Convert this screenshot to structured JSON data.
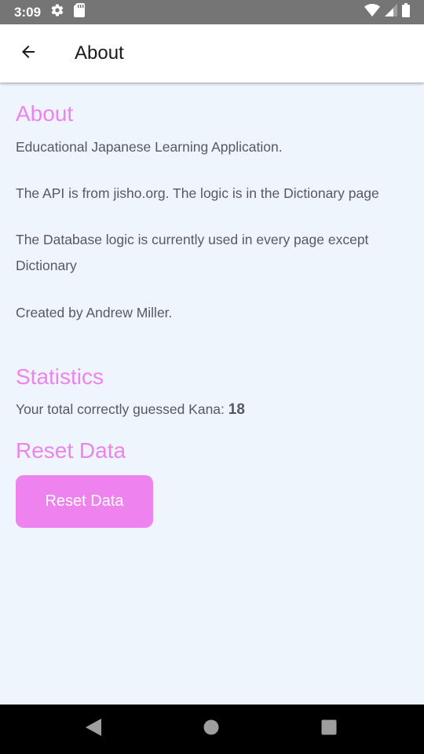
{
  "status_bar": {
    "time": "3:09",
    "icons": [
      "gear-icon",
      "sd-card-icon",
      "wifi-icon",
      "cell-signal-icon",
      "battery-icon"
    ]
  },
  "app_bar": {
    "title": "About",
    "back_icon": "arrow-left-icon"
  },
  "about": {
    "title": "About",
    "paragraphs": [
      "Educational Japanese Learning Application.",
      "The API is from jisho.org. The logic is in the Dictionary page",
      "The Database logic is currently used in every page except Dictionary",
      "Created by Andrew Miller."
    ]
  },
  "statistics": {
    "title": "Statistics",
    "label": "Your total correctly guessed Kana: ",
    "value": "18"
  },
  "reset": {
    "title": "Reset Data",
    "button_label": "Reset Data"
  },
  "nav_bar": {
    "icons": [
      "back-triangle-icon",
      "home-circle-icon",
      "recents-square-icon"
    ]
  },
  "colors": {
    "accent": "#ee82ee",
    "background": "#eef5fc",
    "status_bar": "#757575",
    "text": "#555a60"
  }
}
